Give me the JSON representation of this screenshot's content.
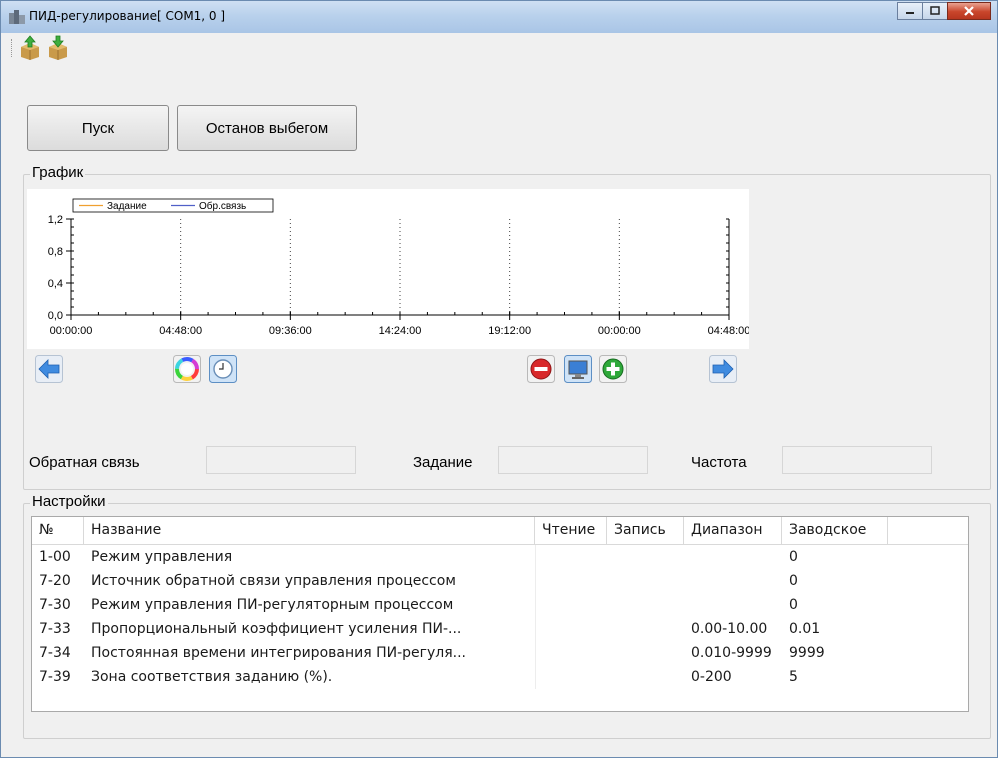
{
  "window": {
    "title": "ПИД-регулирование[ COM1, 0 ]"
  },
  "toolbar": {
    "icons": [
      "box-upload-icon",
      "box-download-icon"
    ]
  },
  "buttons": {
    "start": "Пуск",
    "coast_stop": "Останов выбегом"
  },
  "chart_group": {
    "title": "График"
  },
  "chart_data": {
    "type": "line",
    "series": [
      {
        "name": "Задание",
        "color": "#f0a030",
        "values": []
      },
      {
        "name": "Обр.связь",
        "color": "#5060c8",
        "values": []
      }
    ],
    "y_ticks": [
      "0,0",
      "0,4",
      "0,8",
      "1,2"
    ],
    "ylim": [
      0,
      1.2
    ],
    "x_ticks": [
      "00:00:00",
      "04:48:00",
      "09:36:00",
      "14:24:00",
      "19:12:00",
      "00:00:00",
      "04:48:00"
    ],
    "grid": "vertical dotted",
    "legend": "top-left"
  },
  "chart_controls": {
    "icons": [
      "arrow-left-icon",
      "color-wheel-icon",
      "clock-icon",
      "remove-icon",
      "monitor-icon",
      "add-icon",
      "arrow-right-icon"
    ]
  },
  "readouts": {
    "feedback_label": "Обратная связь",
    "setpoint_label": "Задание",
    "frequency_label": "Частота",
    "feedback_value": "",
    "setpoint_value": "",
    "frequency_value": ""
  },
  "settings_group": {
    "title": "Настройки"
  },
  "table": {
    "columns": [
      "№",
      "Название",
      "Чтение",
      "Запись",
      "Диапазон",
      "Заводское"
    ],
    "rows": [
      {
        "num": "1-00",
        "name": "Режим управления",
        "read": "",
        "write": "",
        "range": "",
        "factory": "0"
      },
      {
        "num": "7-20",
        "name": "Источник обратной связи управления процессом",
        "read": "",
        "write": "",
        "range": "",
        "factory": "0"
      },
      {
        "num": "7-30",
        "name": "Режим управления ПИ-регуляторным процессом",
        "read": "",
        "write": "",
        "range": "",
        "factory": "0"
      },
      {
        "num": "7-33",
        "name": "Пропорциональный коэффициент усиления ПИ-...",
        "read": "",
        "write": "",
        "range": "0.00-10.00",
        "factory": "0.01"
      },
      {
        "num": "7-34",
        "name": "Постоянная времени интегрирования ПИ-регуля...",
        "read": "",
        "write": "",
        "range": "0.010-9999",
        "factory": "9999"
      },
      {
        "num": "7-39",
        "name": "Зона соответствия заданию (%).",
        "read": "",
        "write": "",
        "range": "0-200",
        "factory": "5"
      }
    ]
  }
}
